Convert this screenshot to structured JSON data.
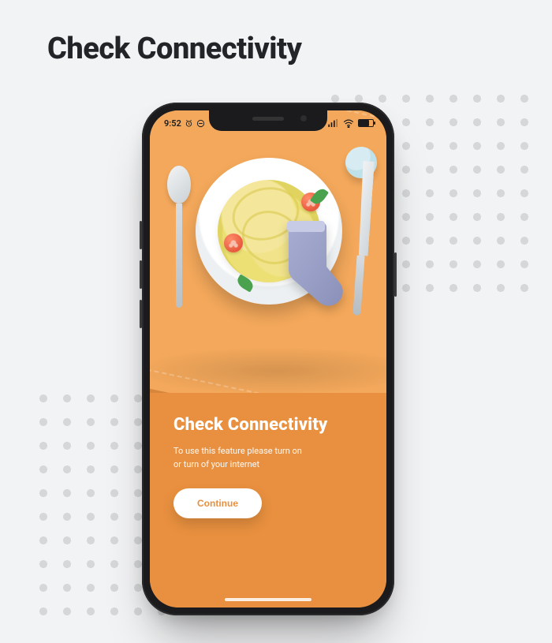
{
  "page": {
    "title": "Check Connectivity"
  },
  "status": {
    "time": "9:52"
  },
  "screen": {
    "heading": "Check Connectivity",
    "body_line1": "To use this feature please turn on",
    "body_line2": "or turn of your internet",
    "button": "Continue"
  },
  "colors": {
    "accent": "#e8903f",
    "accent_light": "#f3a85b"
  }
}
